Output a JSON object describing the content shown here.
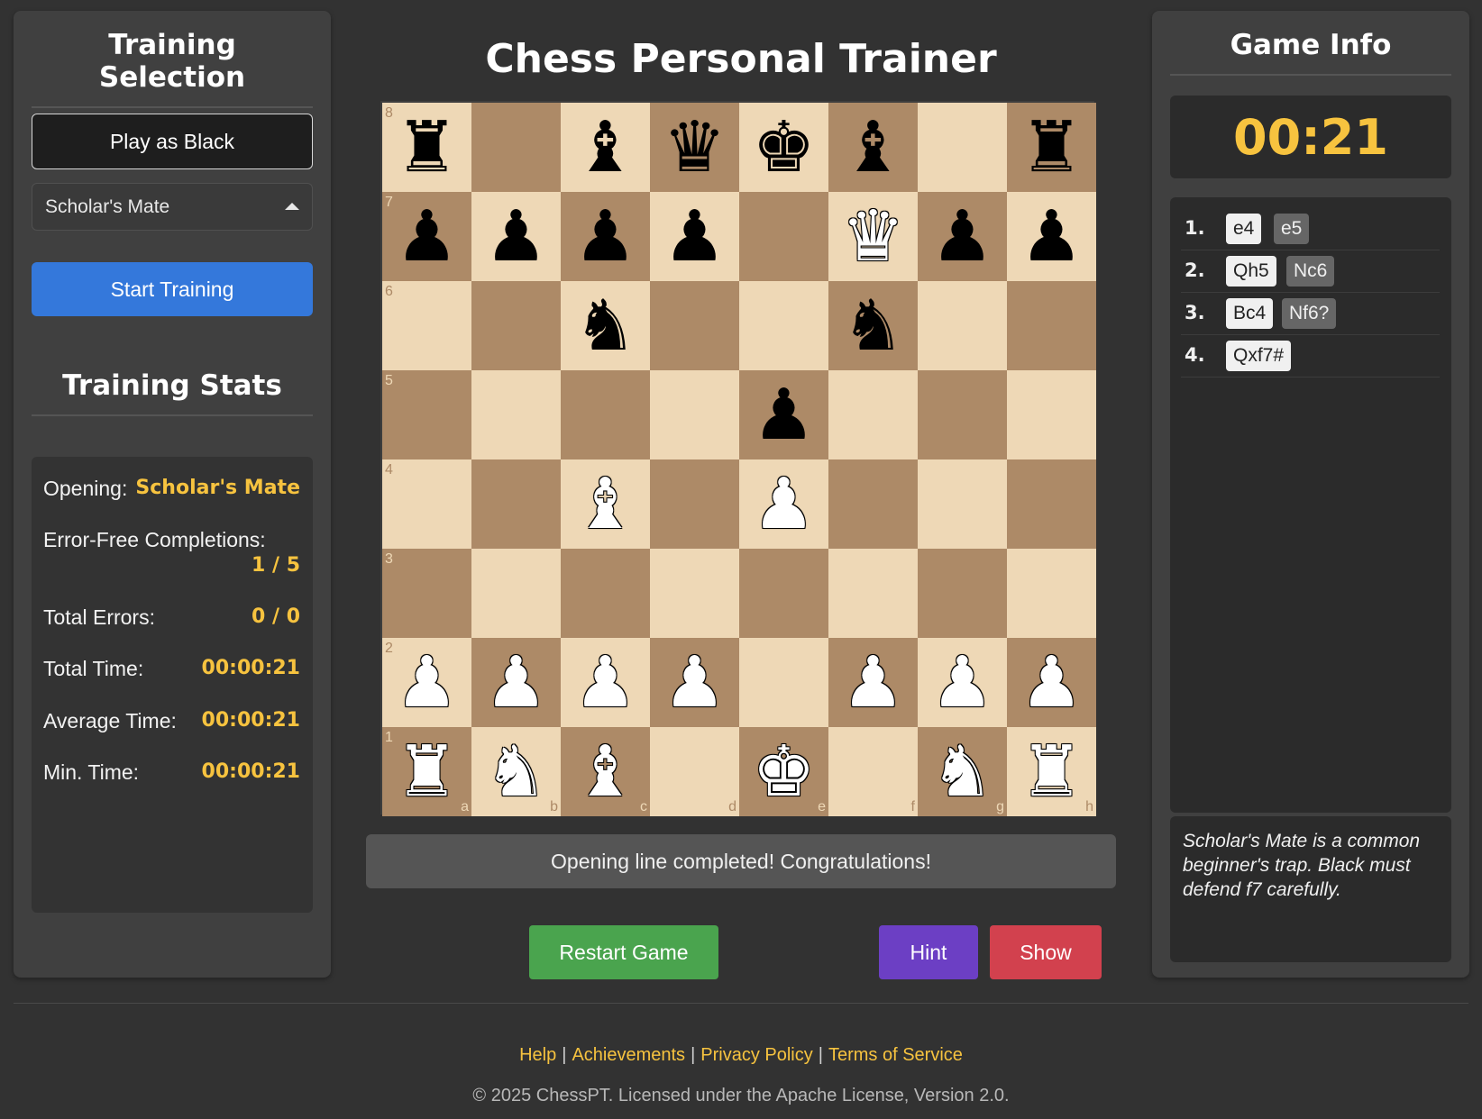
{
  "left_panel": {
    "heading": "Training Selection",
    "play_button": "Play as Black",
    "opening_select": "Scholar's Mate",
    "start_button": "Start Training",
    "stats_heading": "Training Stats",
    "stats": [
      {
        "label": "Opening:",
        "value": "Scholar's Mate"
      },
      {
        "label": "Error-Free Completions:",
        "value": "1 / 5"
      },
      {
        "label": "Total Errors:",
        "value": "0 / 0"
      },
      {
        "label": "Total Time:",
        "value": "00:00:21"
      },
      {
        "label": "Average Time:",
        "value": "00:00:21"
      },
      {
        "label": "Min. Time:",
        "value": "00:00:21"
      }
    ]
  },
  "main": {
    "title": "Chess Personal Trainer",
    "board": {
      "ranks": [
        [
          "br",
          "",
          "bb",
          "bq",
          "bk",
          "bb",
          "",
          "br"
        ],
        [
          "bp",
          "bp",
          "bp",
          "bp",
          "",
          "wq",
          "bp",
          "bp"
        ],
        [
          "",
          "",
          "bn",
          "",
          "",
          "bn",
          "",
          ""
        ],
        [
          "",
          "",
          "",
          "",
          "bp",
          "",
          "",
          ""
        ],
        [
          "",
          "",
          "wb",
          "",
          "wp",
          "",
          "",
          ""
        ],
        [
          "",
          "",
          "",
          "",
          "",
          "",
          "",
          ""
        ],
        [
          "wp",
          "wp",
          "wp",
          "wp",
          "",
          "wp",
          "wp",
          "wp"
        ],
        [
          "wr",
          "wn",
          "wb",
          "",
          "wk",
          "",
          "wn",
          "wr"
        ]
      ],
      "rank_labels": [
        "8",
        "7",
        "6",
        "5",
        "4",
        "3",
        "2",
        "1"
      ],
      "file_labels": [
        "a",
        "b",
        "c",
        "d",
        "e",
        "f",
        "g",
        "h"
      ],
      "light_color": "#eed8b6",
      "dark_color": "#ad8a67"
    },
    "status": "Opening line completed! Congratulations!",
    "restart_button": "Restart Game",
    "hint_button": "Hint",
    "show_button": "Show"
  },
  "right_panel": {
    "heading": "Game Info",
    "timer": "00:21",
    "moves": [
      {
        "num": "1.",
        "white": "e4",
        "black": "e5"
      },
      {
        "num": "2.",
        "white": "Qh5",
        "black": "Nc6"
      },
      {
        "num": "3.",
        "white": "Bc4",
        "black": "Nf6?"
      },
      {
        "num": "4.",
        "white": "Qxf7#",
        "black": ""
      }
    ],
    "description": "Scholar's Mate is a common beginner's trap. Black must defend f7 carefully."
  },
  "footer": {
    "links": [
      "Help",
      "Achievements",
      "Privacy Policy",
      "Terms of Service"
    ],
    "copyright": "© 2025 ChessPT. Licensed under the Apache License, Version 2.0."
  },
  "colors": {
    "accent": "#f7c33f",
    "primary_button": "#3478db",
    "restart_button": "#4aa44e",
    "hint_button": "#6c3fc4",
    "show_button": "#d2414e"
  }
}
